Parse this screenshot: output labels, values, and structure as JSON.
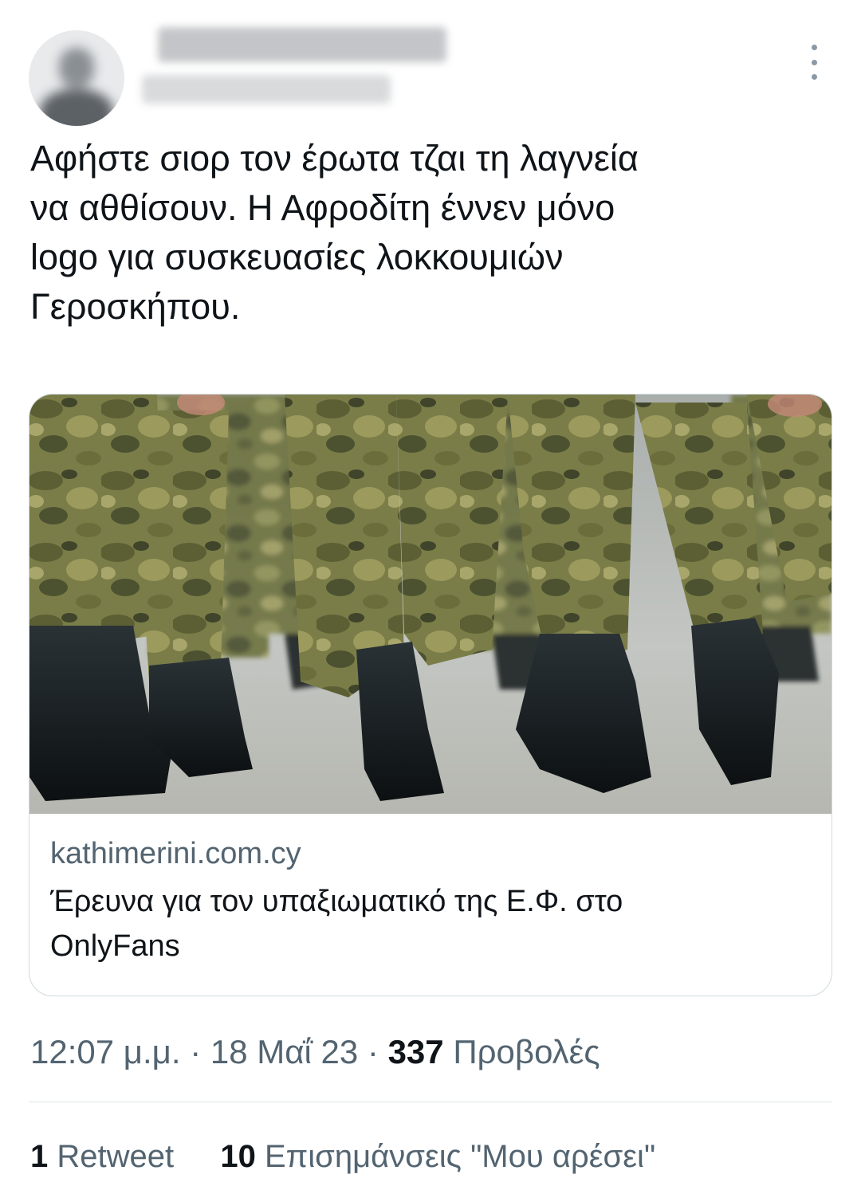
{
  "tweet": {
    "text_lines": [
      "Αφήστε σιορ τον έρωτα τζαι τη λαγνεία",
      "να αθθίσουν. Η Αφροδίτη έννεν μόνο",
      "logo για συσκευασίες λοκκουμιών",
      "Γεροσκήπου."
    ],
    "card": {
      "domain": "kathimerini.com.cy",
      "title_lines": [
        "Έρευνα για τον υπαξιωματικό της Ε.Φ. στο",
        "OnlyFans"
      ]
    },
    "time": "12:07 μ.μ.",
    "separator": "·",
    "date": "18 Μαΐ 23",
    "views_count": "337",
    "views_label": "Προβολές",
    "retweets_count": "1",
    "retweets_label": "Retweet",
    "likes_count": "10",
    "likes_label": "Επισημάνσεις \"Μου αρέσει\""
  },
  "icons": {
    "more": "more-vertical-icon"
  },
  "colors": {
    "text": "#0f1419",
    "secondary": "#536471",
    "border": "#cfd9de"
  }
}
